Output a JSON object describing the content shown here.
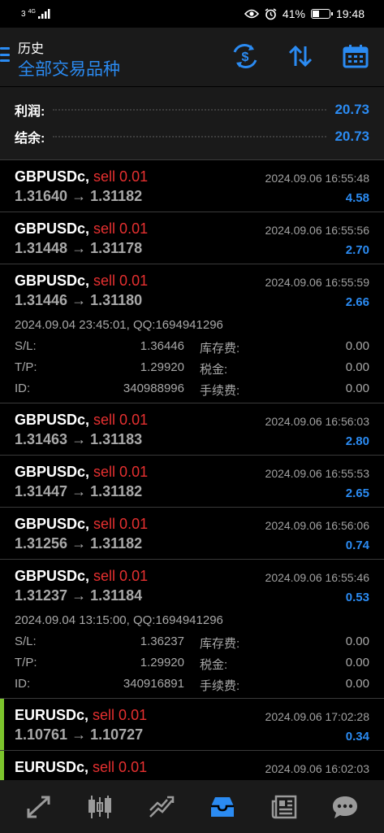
{
  "status_bar": {
    "network": "3",
    "net_type": "4G",
    "battery": "41%",
    "battery_level": 0.41,
    "time": "19:48"
  },
  "header": {
    "small_title": "历史",
    "main_title": "全部交易品种",
    "icons": [
      "currency-swap-icon",
      "sort-icon",
      "calendar-icon"
    ]
  },
  "summary": {
    "profit_label": "利润:",
    "profit_value": "20.73",
    "balance_label": "结余:",
    "balance_value": "20.73"
  },
  "deals": [
    {
      "symbol": "GBPUSDc,",
      "side": "sell 0.01",
      "time": "2024.09.06 16:55:48",
      "prices": "1.31640 → 1.31182",
      "profit": "4.58"
    },
    {
      "symbol": "GBPUSDc,",
      "side": "sell 0.01",
      "time": "2024.09.06 16:55:56",
      "prices": "1.31448 → 1.31178",
      "profit": "2.70"
    },
    {
      "symbol": "GBPUSDc,",
      "side": "sell 0.01",
      "time": "2024.09.06 16:55:59",
      "prices": "1.31446 → 1.31180",
      "profit": "2.66",
      "open_info": "2024.09.04 23:45:01, QQ:1694941296",
      "sl_label": "S/L:",
      "sl": "1.36446",
      "swap_label": "库存费:",
      "swap": "0.00",
      "tp_label": "T/P:",
      "tp": "1.29920",
      "tax_label": "税金:",
      "tax": "0.00",
      "id_label": "ID:",
      "id": "340988996",
      "fee_label": "手续费:",
      "fee": "0.00"
    },
    {
      "symbol": "GBPUSDc,",
      "side": "sell 0.01",
      "time": "2024.09.06 16:56:03",
      "prices": "1.31463 → 1.31183",
      "profit": "2.80"
    },
    {
      "symbol": "GBPUSDc,",
      "side": "sell 0.01",
      "time": "2024.09.06 16:55:53",
      "prices": "1.31447 → 1.31182",
      "profit": "2.65"
    },
    {
      "symbol": "GBPUSDc,",
      "side": "sell 0.01",
      "time": "2024.09.06 16:56:06",
      "prices": "1.31256 → 1.31182",
      "profit": "0.74"
    },
    {
      "symbol": "GBPUSDc,",
      "side": "sell 0.01",
      "time": "2024.09.06 16:55:46",
      "prices": "1.31237 → 1.31184",
      "profit": "0.53",
      "open_info": "2024.09.04 13:15:00, QQ:1694941296",
      "sl_label": "S/L:",
      "sl": "1.36237",
      "swap_label": "库存费:",
      "swap": "0.00",
      "tp_label": "T/P:",
      "tp": "1.29920",
      "tax_label": "税金:",
      "tax": "0.00",
      "id_label": "ID:",
      "id": "340916891",
      "fee_label": "手续费:",
      "fee": "0.00"
    },
    {
      "symbol": "EURUSDc,",
      "side": "sell 0.01",
      "time": "2024.09.06 17:02:28",
      "prices": "1.10761 → 1.10727",
      "profit": "0.34"
    },
    {
      "symbol": "EURUSDc,",
      "side": "sell 0.01",
      "time": "2024.09.06 16:02:03",
      "prices": "",
      "profit": ""
    }
  ],
  "bottom_nav": [
    "quotes-icon",
    "chart-icon",
    "trade-icon",
    "history-icon",
    "news-icon",
    "chat-icon"
  ],
  "colors": {
    "accent": "#2b8bf2",
    "sell": "#e63030",
    "eur_marker": "#7cc42c"
  }
}
